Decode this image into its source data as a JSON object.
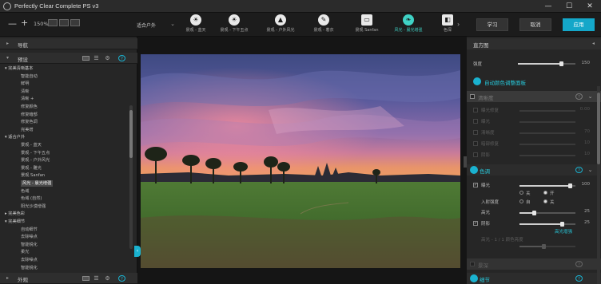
{
  "app": {
    "title": "Perfectly Clear Complete PS v3",
    "window_controls": [
      "—",
      "☐",
      "✕"
    ]
  },
  "toolbar": {
    "zoom_minus": "—",
    "zoom_plus": "+",
    "zoom_level": "150%",
    "preset_selected": "适合户外",
    "quick_presets": [
      {
        "label": "景观 - 蓝天",
        "icon": "☀"
      },
      {
        "label": "景观 - 下午五点",
        "icon": "☀"
      },
      {
        "label": "景观 - 户外风光",
        "icon": "▲"
      },
      {
        "label": "景观 - 着衣",
        "icon": "✎"
      },
      {
        "label": "景观 Sanfan",
        "icon": "▭"
      },
      {
        "label": "风光 - 晨光增强",
        "icon": "❧"
      },
      {
        "label": "色深",
        "icon": "◧"
      }
    ],
    "more_arrow": "›",
    "learn_label": "学习",
    "cancel_label": "取消",
    "apply_label": "应用"
  },
  "left_panel": {
    "nav_header": "导航",
    "presets_header": "预设",
    "appearance_header": "外观",
    "tree": [
      {
        "text": "▾ 完美清晰基本",
        "kind": "group"
      },
      {
        "text": "智能自动",
        "kind": "item"
      },
      {
        "text": "鲜明",
        "kind": "item"
      },
      {
        "text": "清晰",
        "kind": "item"
      },
      {
        "text": "清晰 +",
        "kind": "item"
      },
      {
        "text": "修复颜色",
        "kind": "item"
      },
      {
        "text": "修复暗部",
        "kind": "item"
      },
      {
        "text": "修复色调",
        "kind": "item"
      },
      {
        "text": "完美增",
        "kind": "item"
      },
      {
        "text": "▾ 适合户外",
        "kind": "group"
      },
      {
        "text": "景观 - 蓝天",
        "kind": "item"
      },
      {
        "text": "景观 - 下午五点",
        "kind": "item"
      },
      {
        "text": "景观 - 户外风光",
        "kind": "item"
      },
      {
        "text": "景观 - 雕光",
        "kind": "item"
      },
      {
        "text": "景观 Sanfan",
        "kind": "item"
      },
      {
        "text": "风光 - 晨光增强",
        "kind": "selected"
      },
      {
        "text": "色域",
        "kind": "item"
      },
      {
        "text": "色域 (自然)",
        "kind": "item"
      },
      {
        "text": "阳光沙漠增强",
        "kind": "item"
      },
      {
        "text": "▸ 完美色彩",
        "kind": "group"
      },
      {
        "text": "▾ 完美细节",
        "kind": "group"
      },
      {
        "text": "自动细节",
        "kind": "item"
      },
      {
        "text": "去除噪点",
        "kind": "item"
      },
      {
        "text": "智能锐化",
        "kind": "item"
      },
      {
        "text": "柔光",
        "kind": "item"
      },
      {
        "text": "去除噪点",
        "kind": "item"
      },
      {
        "text": "智能锐化",
        "kind": "item"
      }
    ]
  },
  "right_panel": {
    "histogram_header": "直方图",
    "strength_label": "强度",
    "strength_value": "150",
    "strength_level": 0.75,
    "auto_label": "自动颜色调整面板",
    "clarity_header": "清晰度",
    "clarity_rows": [
      {
        "label": "曝光修复",
        "value": "0.00"
      },
      {
        "label": "曝光",
        "value": ""
      },
      {
        "label": "清晰度",
        "value": "70"
      },
      {
        "label": "暗部修复",
        "value": "10"
      },
      {
        "label": "阴影",
        "value": "10"
      }
    ],
    "color_header": "色调",
    "color_rows": [
      {
        "label": "曝光",
        "value": "100",
        "level": 0.9
      },
      {
        "label": "入射强度",
        "value": "",
        "level": null
      },
      {
        "label": "高光",
        "value": "25",
        "level": 0.25
      },
      {
        "label": "阴影",
        "value": "25",
        "level": 0.75
      },
      {
        "label": "高光 - 1 / 1 颜色亮度",
        "value": "",
        "level": null
      }
    ],
    "radio_labels": [
      "关",
      "开",
      "自",
      "关"
    ],
    "auto_tone_label": "高光增强",
    "depth_header": "景深",
    "details_header": "细节",
    "help": "?"
  },
  "colors": {
    "accent": "#1ab2d0",
    "accent_teal": "#3fd2c5",
    "apply_button": "#14a7c9",
    "bg_dark": "#1e1e1e",
    "panel": "#262626"
  }
}
